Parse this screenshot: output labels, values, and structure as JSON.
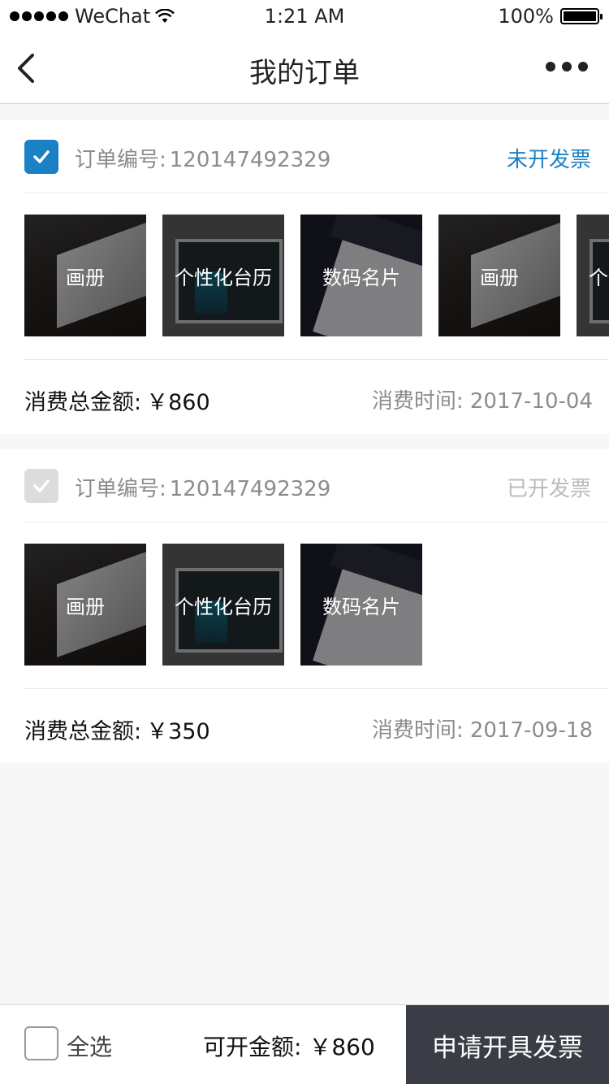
{
  "status_bar": {
    "carrier": "WeChat",
    "time": "1:21 AM",
    "battery": "100%"
  },
  "nav": {
    "title": "我的订单"
  },
  "orders": [
    {
      "order_label": "订单编号:",
      "order_number": "120147492329",
      "invoice_status": "未开发票",
      "checked": true,
      "products": [
        {
          "name": "画册",
          "image": "album"
        },
        {
          "name": "个性化台历",
          "image": "calendar"
        },
        {
          "name": "数码名片",
          "image": "card"
        },
        {
          "name": "画册",
          "image": "album"
        },
        {
          "name": "个性化台历",
          "image": "calendar"
        }
      ],
      "total_label": "消费总金额:",
      "total_amount": "￥860",
      "time_label": "消费时间:",
      "time_value": "2017-10-04"
    },
    {
      "order_label": "订单编号:",
      "order_number": "120147492329",
      "invoice_status": "已开发票",
      "checked": false,
      "products": [
        {
          "name": "画册",
          "image": "album"
        },
        {
          "name": "个性化台历",
          "image": "calendar"
        },
        {
          "name": "数码名片",
          "image": "card"
        }
      ],
      "total_label": "消费总金额:",
      "total_amount": "￥350",
      "time_label": "消费时间:",
      "time_value": "2017-09-18"
    }
  ],
  "bottom_bar": {
    "select_all_label": "全选",
    "available_label": "可开金额:",
    "available_amount": "￥860",
    "submit_label": "申请开具发票"
  },
  "colors": {
    "accent": "#1b80c4",
    "submit_bg": "#3a3d46",
    "muted_text": "#8c8c8c"
  }
}
